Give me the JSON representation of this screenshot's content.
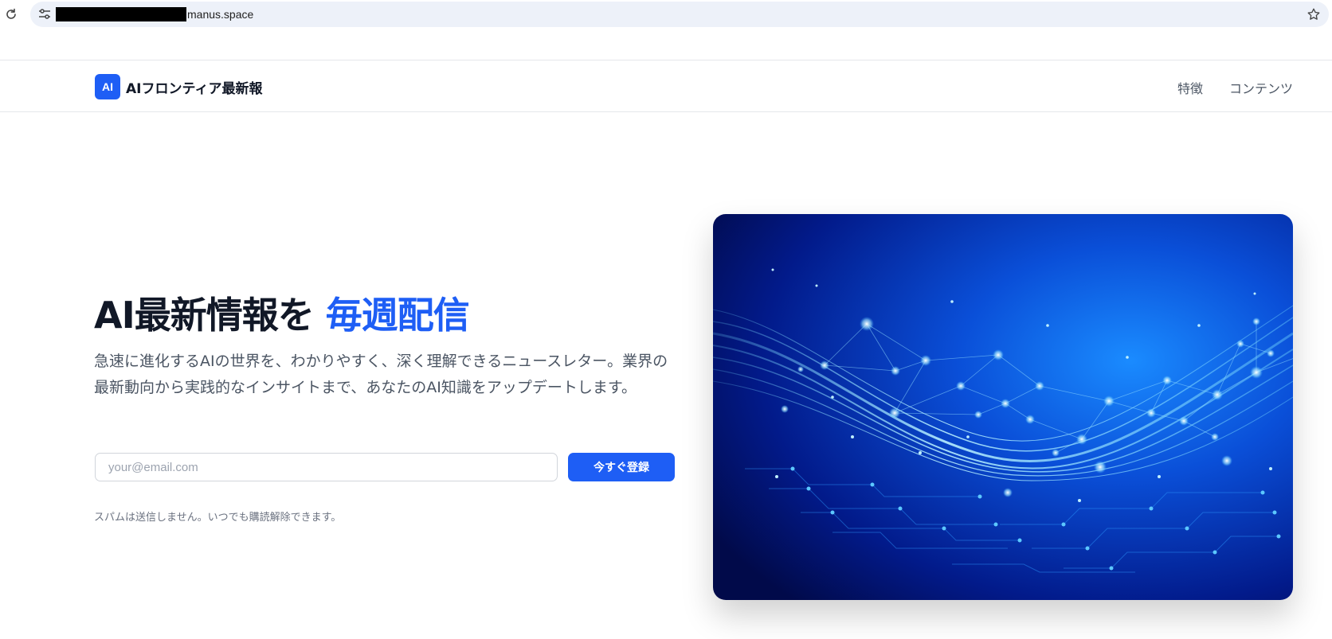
{
  "browser": {
    "url": "manus.space",
    "icons": [
      "reload-icon",
      "site-info-icon",
      "bookmark-star-icon"
    ]
  },
  "header": {
    "logo_badge": "AI",
    "logo_text": "AIフロンティア最新報",
    "nav": [
      {
        "label": "特徴"
      },
      {
        "label": "コンテンツ"
      }
    ]
  },
  "hero": {
    "title_main": "AI最新情報を",
    "title_accent": "毎週配信",
    "description": "急速に進化するAIの世界を、わかりやすく、深く理解できるニュースレター。業界の最新動向から実践的なインサイトまで、あなたのAI知識をアップデートします。",
    "email_placeholder": "your@email.com",
    "email_value": "",
    "signup_label": "今すぐ登録",
    "note": "スパムは送信しません。いつでも購読解除できます。"
  },
  "colors": {
    "accent": "#1e5ef5",
    "text_primary": "#111827",
    "text_secondary": "#4b5563"
  }
}
